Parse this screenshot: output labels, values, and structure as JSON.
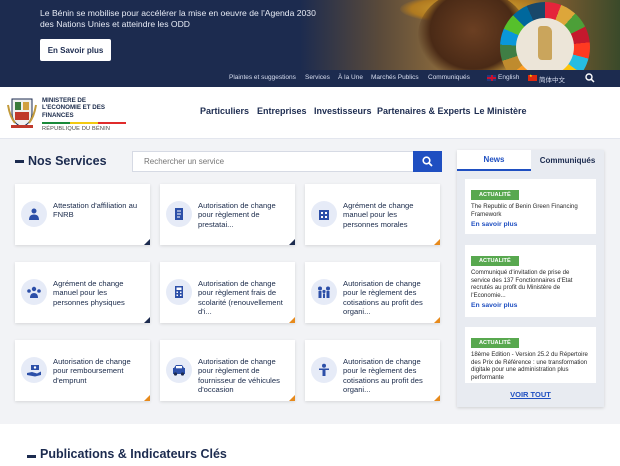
{
  "hero": {
    "text": "Le Bénin se mobilise pour accélérer la mise en oeuvre de l'Agenda 2030 des Nations Unies et atteindre les ODD",
    "button": "En Savoir plus"
  },
  "topbar": {
    "links": [
      "Plaintes et suggestions",
      "Services",
      "À la Une",
      "Marchés Publics",
      "Communiqués"
    ],
    "lang_en": "English",
    "lang_cn": "简体中文"
  },
  "header": {
    "ministry_name": "MINISTERE DE L'ECONOMIE ET DES FINANCES",
    "country": "RÉPUBLIQUE DU BÉNIN",
    "nav": [
      "Particuliers",
      "Entreprises",
      "Investisseurs",
      "Partenaires & Experts",
      "Le Ministère"
    ]
  },
  "services": {
    "title": "Nos Services",
    "search_placeholder": "Rechercher un service",
    "cards": [
      {
        "label": "Attestation d'affiliation au FNRB",
        "icon": "person-id-icon"
      },
      {
        "label": "Autorisation de change pour règlement de prestatai...",
        "icon": "document-icon"
      },
      {
        "label": "Agrément de change manuel pour les personnes morales",
        "icon": "building-icon"
      },
      {
        "label": "Agrément de change manuel pour les personnes physiques",
        "icon": "people-group-icon"
      },
      {
        "label": "Autorisation de change pour règlement frais de scolarité (renouvellement d'i...",
        "icon": "calculator-icon"
      },
      {
        "label": "Autorisation de change pour le règlement des cotisations au profit des organi...",
        "icon": "family-icon"
      },
      {
        "label": "Autorisation de change pour remboursement d'emprunt",
        "icon": "hand-money-icon"
      },
      {
        "label": "Autorisation de change pour règlement de fournisseur de véhicules d'occasion",
        "icon": "car-icon"
      },
      {
        "label": "Autorisation de change pour le règlement des cotisations au profit des organi...",
        "icon": "person-icon"
      }
    ]
  },
  "news": {
    "tabs": [
      "News",
      "Communiqués"
    ],
    "items": [
      {
        "badge": "ACTUALITÉ",
        "text": "The Republic of Benin Green Financing Framework",
        "more": "En savoir plus"
      },
      {
        "badge": "ACTUALITÉ",
        "text": "Communiqué d'invitation de prise de service des 137 Fonctionnaires d'Etat recrutés au profit du Ministère de l'Economie...",
        "more": "En savoir plus"
      },
      {
        "badge": "ACTUALITÉ",
        "text": "18ème Edition - Version 25.2 du Répertoire des Prix de Référence : une transformation digitale pour une administration plus performante",
        "more": ""
      }
    ],
    "see_all": "VOIR TOUT"
  },
  "publications": {
    "title": "Publications & Indicateurs Clés"
  },
  "colors": {
    "navy": "#1c2b4f",
    "accent_blue": "#1f4fc1",
    "badge_green": "#58a84f",
    "corner_orange": "#e78a1c"
  }
}
